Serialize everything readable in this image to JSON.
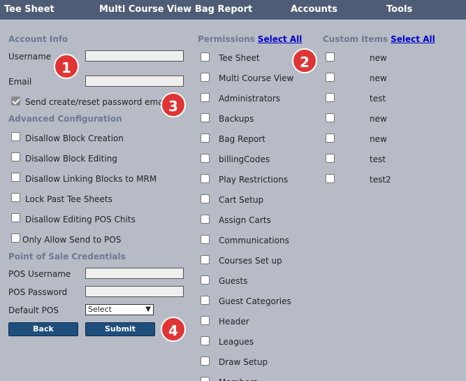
{
  "nav": [
    "Tee Sheet",
    "Multi Course View",
    "Bag Report",
    "Accounts",
    "Tools"
  ],
  "account": {
    "title": "Account Info",
    "username_label": "Username",
    "email_label": "Email",
    "send_email_label": "Send create/reset password email"
  },
  "advanced": {
    "title": "Advanced Configuration",
    "items": [
      "Disallow Block Creation",
      "Disallow Block Editing",
      "Disallow Linking Blocks to MRM",
      "Lock Past Tee Sheets",
      "Disallow Editing POS Chits",
      "Only Allow Send to POS"
    ]
  },
  "pos": {
    "title": "Point of Sale Credentials",
    "username_label": "POS Username",
    "password_label": "POS Password",
    "default_label": "Default POS",
    "select_value": "Select"
  },
  "buttons": {
    "back": "Back",
    "submit": "Submit"
  },
  "permissions": {
    "title": "Permissions",
    "select_all": "Select All",
    "items": [
      "Tee Sheet",
      "Multi Course View",
      "Administrators",
      "Backups",
      "Bag Report",
      "billingCodes",
      "Play Restrictions",
      "Cart Setup",
      "Assign Carts",
      "Communications",
      "Courses Set up",
      "Guests",
      "Guest Categories",
      "Header",
      "Leagues",
      "Draw Setup",
      "Members"
    ]
  },
  "custom": {
    "title": "Custom Items",
    "select_all": "Select All",
    "items": [
      "new",
      "new",
      "test",
      "new",
      "new",
      "test",
      "test2"
    ]
  },
  "badges": [
    "1",
    "2",
    "3",
    "4"
  ]
}
